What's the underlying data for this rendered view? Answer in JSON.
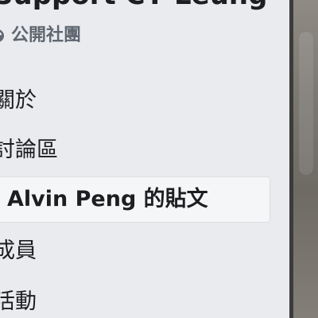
{
  "group": {
    "name": "Support CY Leung",
    "privacy": "公開社團",
    "privacy_icon": "globe-icon"
  },
  "nav": {
    "items": [
      {
        "label": "關於"
      },
      {
        "label": "討論區"
      },
      {
        "label": "Alvin Peng 的貼文",
        "active": true
      },
      {
        "label": "成員"
      },
      {
        "label": "活動"
      }
    ]
  },
  "colors": {
    "sidebar_bg": "#e9ebee",
    "active_item_bg": "#f5f6f7",
    "active_item_border": "#dddfe2",
    "text_primary": "#1c1e21",
    "text_secondary": "#606770"
  }
}
